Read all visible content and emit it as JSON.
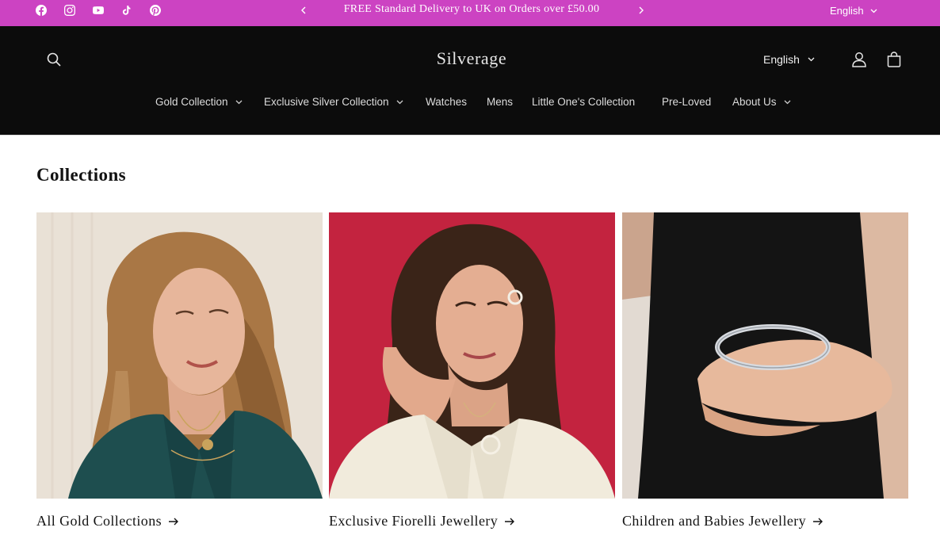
{
  "announcement": {
    "text": "FREE Standard Delivery to UK on Orders over £50.00",
    "language": "English",
    "background": "#cc43c2"
  },
  "social_icons": [
    "facebook-icon",
    "instagram-icon",
    "youtube-icon",
    "tiktok-icon",
    "pinterest-icon"
  ],
  "header": {
    "logo": "Silverage",
    "language": "English",
    "background": "#0c0c0c"
  },
  "nav": {
    "items": [
      {
        "label": "Gold Collection",
        "has_dropdown": true
      },
      {
        "label": "Exclusive Silver Collection",
        "has_dropdown": true
      },
      {
        "label": "Watches",
        "has_dropdown": false
      },
      {
        "label": "Mens",
        "has_dropdown": false
      },
      {
        "label": "Little One's Collection",
        "has_dropdown": false
      },
      {
        "label": "Pre-Loved",
        "has_dropdown": false
      },
      {
        "label": "About Us",
        "has_dropdown": true
      }
    ]
  },
  "main": {
    "title": "Collections",
    "collections": [
      {
        "title": "All Gold Collections"
      },
      {
        "title": "Exclusive Fiorelli Jewellery"
      },
      {
        "title": "Children and Babies Jewellery"
      }
    ]
  }
}
